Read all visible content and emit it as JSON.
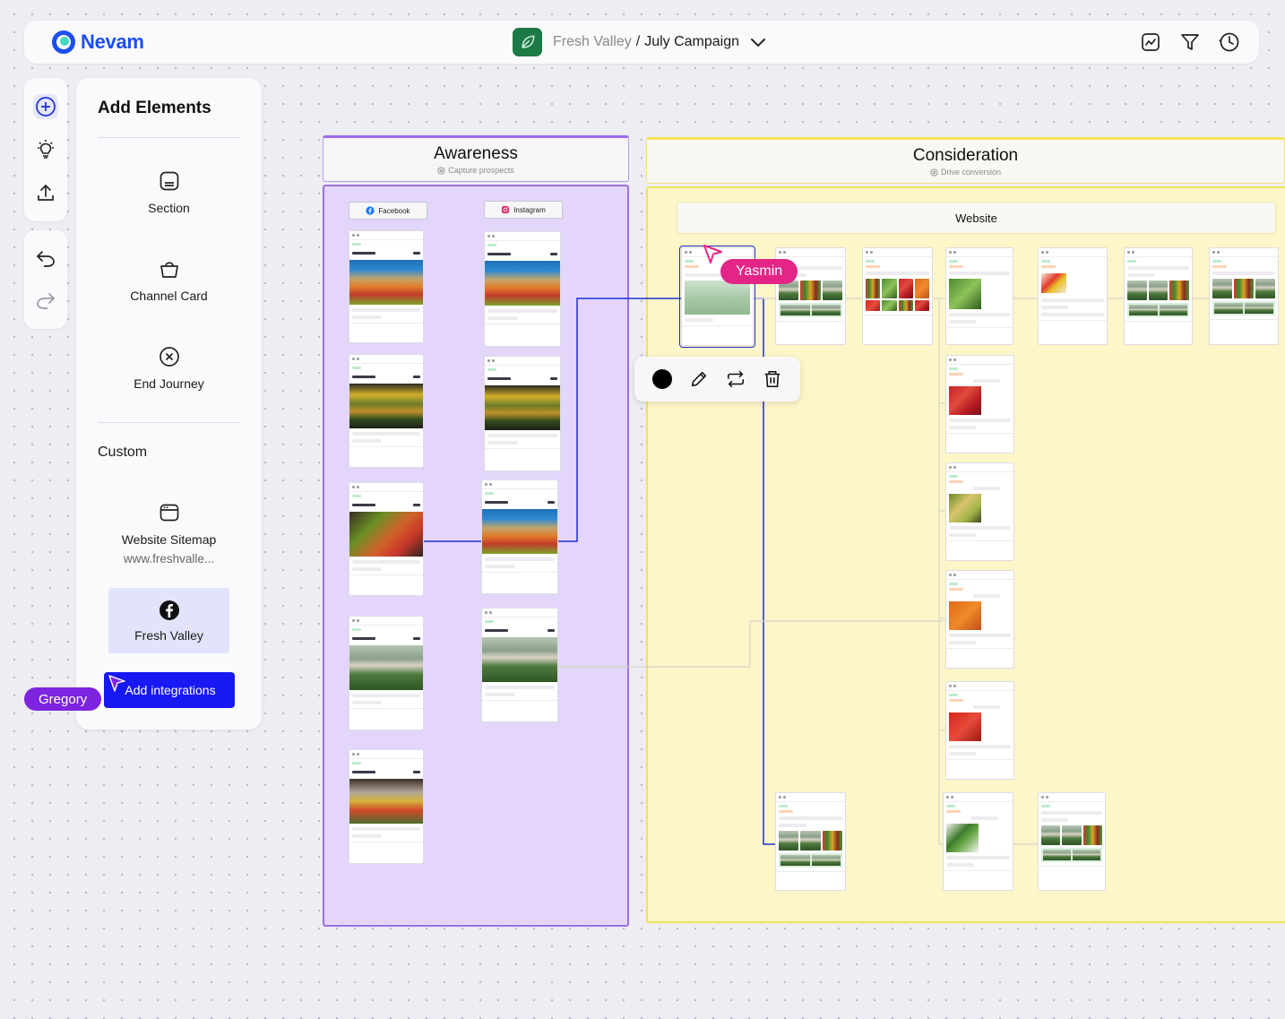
{
  "app": {
    "logo_text": "Nevam",
    "client": "Fresh Valley",
    "separator": "/",
    "campaign": "July Campaign",
    "colors": {
      "brand": "#1d4ef0",
      "accent": "#3fd8c3",
      "client_chip": "#1e7a45"
    }
  },
  "topbar": {
    "icons": [
      "analytics-icon",
      "filter-icon",
      "history-icon"
    ]
  },
  "rail": {
    "tools": [
      "add-icon",
      "lightbulb-icon",
      "upload-icon"
    ],
    "history": [
      "undo-icon",
      "redo-icon"
    ]
  },
  "panel": {
    "title": "Add Elements",
    "elements": [
      {
        "label": "Section",
        "icon": "section-icon"
      },
      {
        "label": "Channel Card",
        "icon": "bag-icon"
      },
      {
        "label": "End Journey",
        "icon": "close-circle-icon"
      }
    ],
    "custom_label": "Custom",
    "sitemap": {
      "label": "Website Sitemap",
      "url": "www.freshvalle..."
    },
    "integration": {
      "label": "Fresh Valley",
      "icon": "facebook-icon"
    },
    "add_integrations": "Add integrations"
  },
  "collaborators": {
    "gregory": {
      "name": "Gregory",
      "color": "#7d24e0"
    },
    "yasmin": {
      "name": "Yasmin",
      "color": "#e32586"
    }
  },
  "columns": {
    "awareness": {
      "title": "Awareness",
      "subtitle": "Capture prospects",
      "color": "#9b6fe2"
    },
    "consideration": {
      "title": "Consideration",
      "subtitle": "Drive conversion",
      "color": "#f2e15b"
    }
  },
  "channels": {
    "facebook": "Facebook",
    "instagram": "Instagram",
    "website": "Website"
  },
  "toolbar": {
    "icons": [
      "color-swatch",
      "pencil-icon",
      "swap-icon",
      "trash-icon"
    ],
    "swatch_color": "#000000"
  }
}
